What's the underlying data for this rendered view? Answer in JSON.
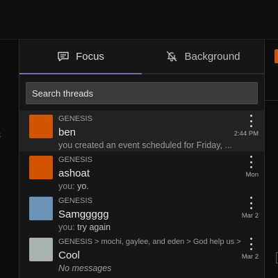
{
  "tabs": [
    {
      "label": "Focus",
      "icon": "chat-bubble-icon",
      "active": true
    },
    {
      "label": "Background",
      "icon": "bell-off-icon",
      "active": false
    }
  ],
  "search": {
    "placeholder": "Search threads"
  },
  "threads": [
    {
      "community": "GENESIS",
      "name": "ben",
      "you": "",
      "message": "you created an event scheduled for Friday, ...",
      "time": "2:44 PM",
      "color": "#d35400",
      "italic": false
    },
    {
      "community": "GENESIS",
      "name": "ashoat",
      "you": "you: ",
      "message": "yo.",
      "time": "Mon",
      "color": "#d35400",
      "italic": false
    },
    {
      "community": "GENESIS",
      "name": "Samggggg",
      "you": "you: ",
      "message": "try again",
      "time": "Mar 2",
      "color": "#6b93b8",
      "italic": false
    },
    {
      "community": "GENESIS > mochi, gaylee, and eden > God help us > \\",
      "name": "Cool",
      "you": "",
      "message": "No messages",
      "time": "Mar 2",
      "color": "#a8b3b0",
      "italic": true
    }
  ],
  "colors": {
    "accent": "#7d6aa6",
    "thread_orange": "#d35400",
    "background": "#161616"
  }
}
